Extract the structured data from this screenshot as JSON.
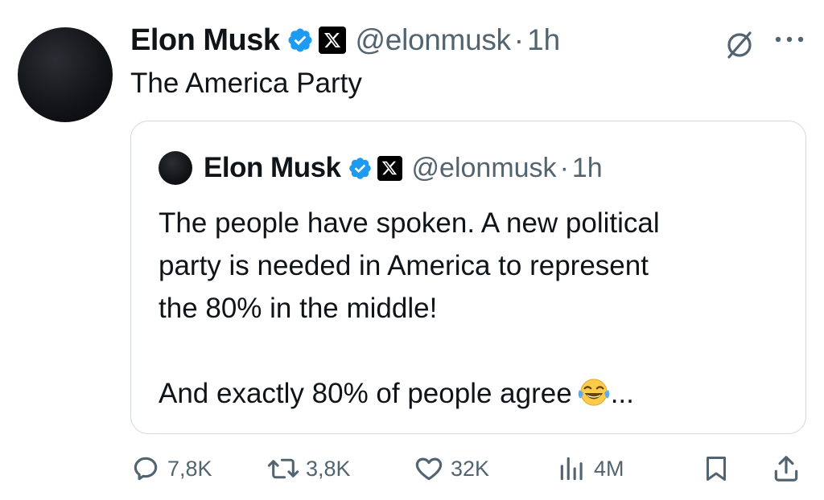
{
  "author": {
    "name": "Elon Musk",
    "handle": "@elonmusk",
    "separator": "·",
    "time": "1h"
  },
  "post_text": "The America Party",
  "quoted": {
    "name": "Elon Musk",
    "handle": "@elonmusk",
    "separator": "·",
    "time": "1h",
    "lines": [
      "The people have spoken. A new political",
      "party is needed in America to represent",
      "the 80% in the middle!"
    ],
    "last_line": "And exactly 80% of people agree",
    "last_line_suffix": "...",
    "emoji": "tears-of-joy-emoji"
  },
  "actions": {
    "replies": "7,8K",
    "reposts": "3,8K",
    "likes": "32K",
    "views": "4M"
  },
  "colors": {
    "verified": "#1d9bf0",
    "muted": "#536471",
    "text": "#0f1419",
    "border": "#cfd9de"
  }
}
